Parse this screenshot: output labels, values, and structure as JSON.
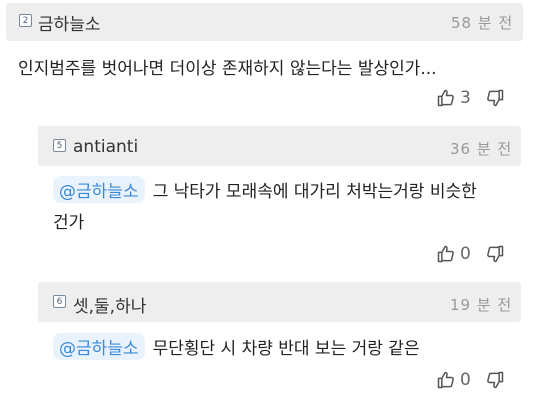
{
  "comments": [
    {
      "level_badge": "2",
      "author": "금하늘소",
      "time": "58 분 전",
      "mention": "",
      "text": "인지범주를 벗어나면 더이상 존재하지 않는다는 발상인가...",
      "text_cont": "",
      "likes": "3"
    },
    {
      "level_badge": "5",
      "author": "antianti",
      "time": "36 분 전",
      "mention": "@금하늘소",
      "text": "그 낙타가 모래속에 대가리 처박는거랑 비슷한",
      "text_cont": "건가",
      "likes": "0"
    },
    {
      "level_badge": "6",
      "author": "셋,둘,하나",
      "time": "19 분 전",
      "mention": "@금하늘소",
      "text": "무단횡단 시 차량 반대 보는 거랑 같은",
      "text_cont": "",
      "likes": "0"
    }
  ],
  "colors": {
    "header_bg": "#eeeeee",
    "mention_bg": "#e9f3fd",
    "mention_text": "#3a88d8",
    "muted": "#999999"
  },
  "icons": {
    "like": "thumbs-up-icon",
    "dislike": "thumbs-down-icon"
  }
}
